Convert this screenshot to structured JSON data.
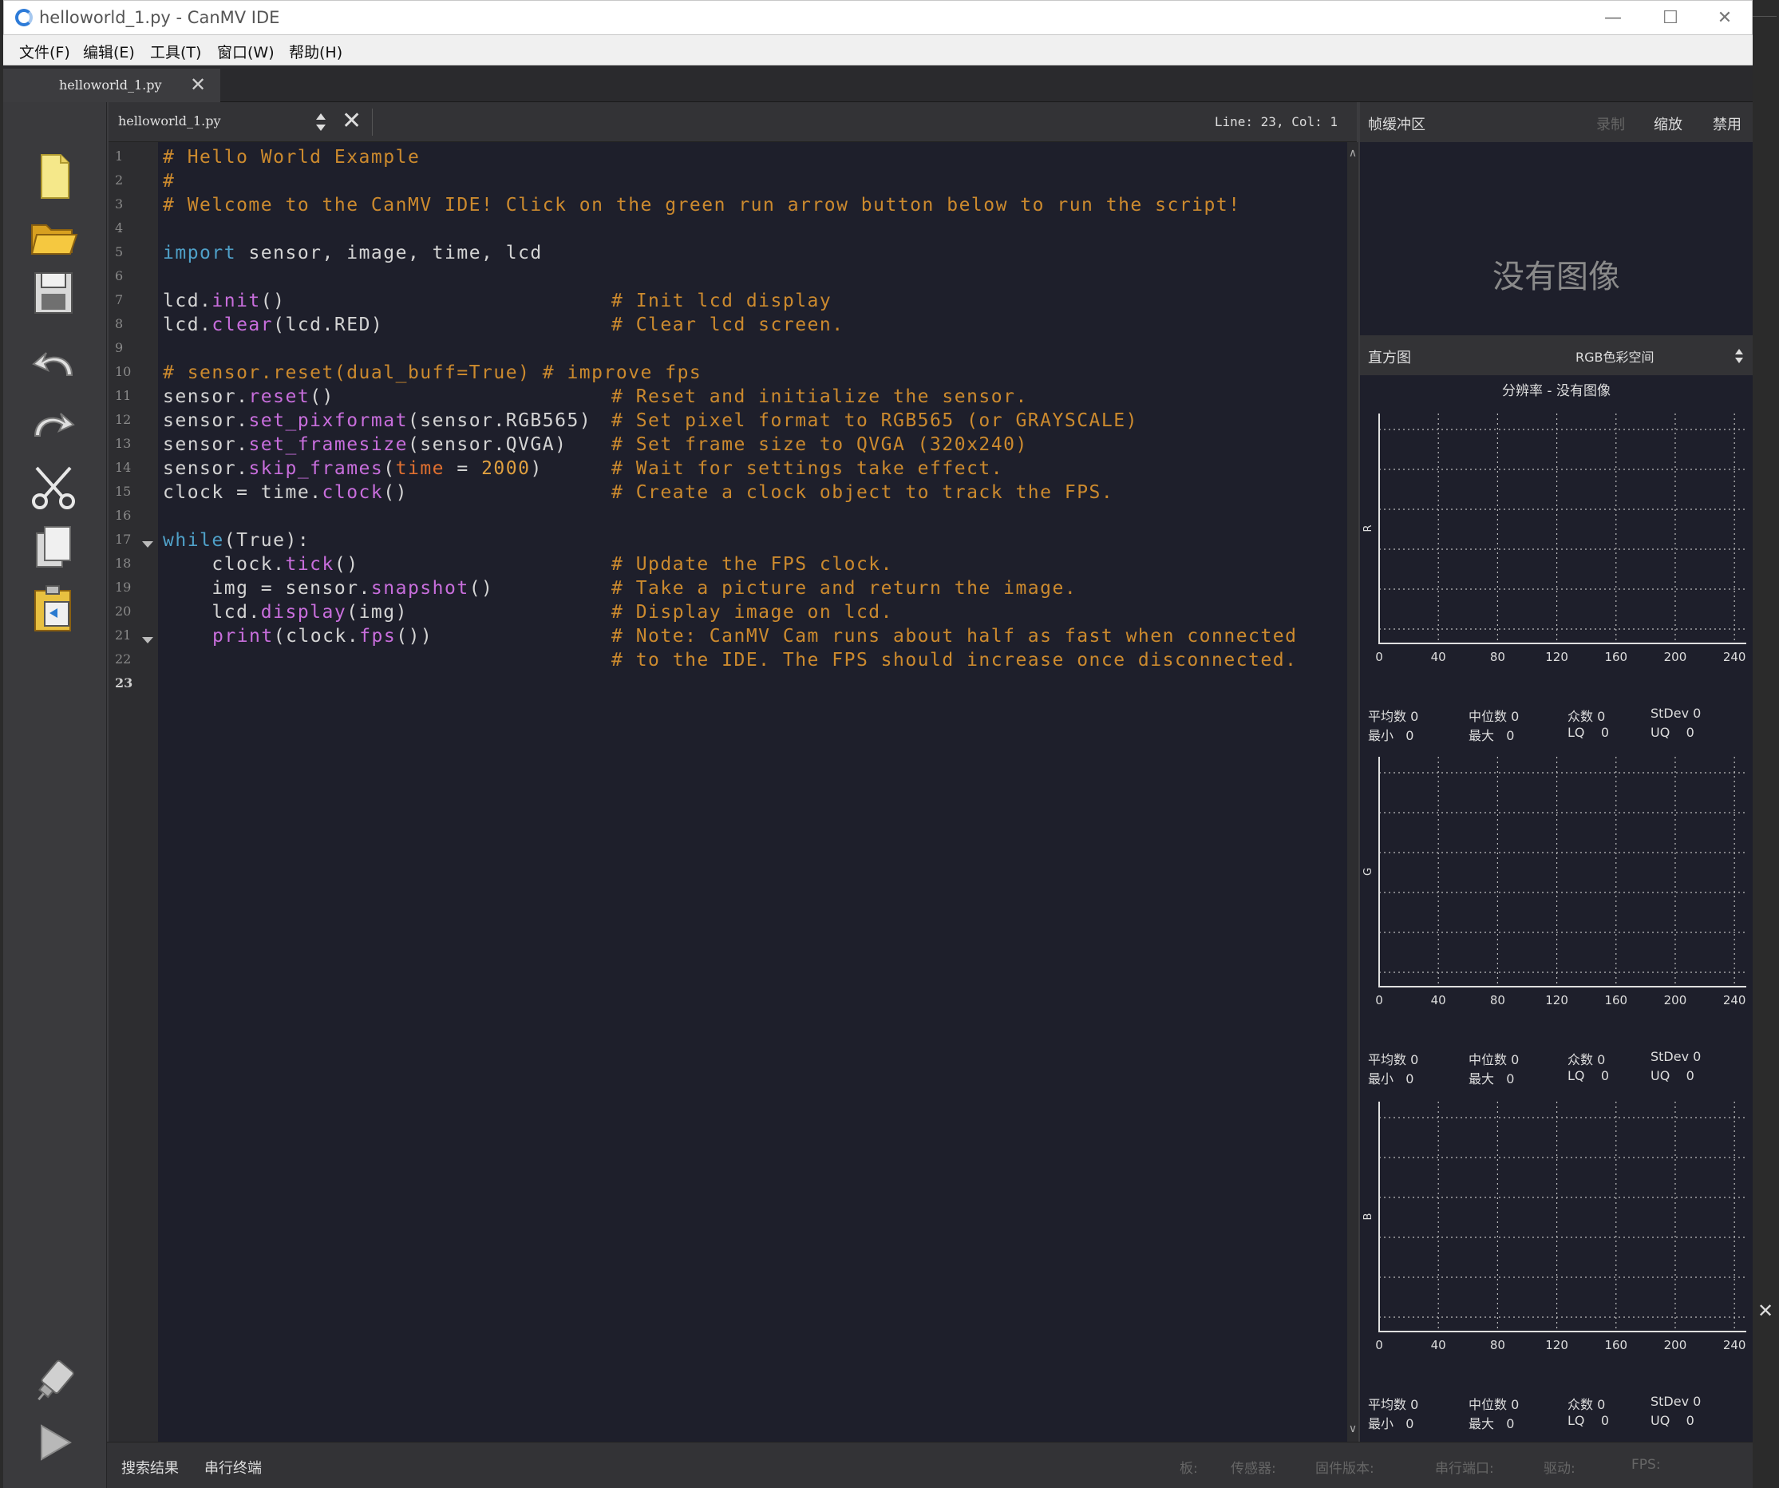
{
  "window": {
    "title": "helloworld_1.py - CanMV IDE"
  },
  "menu": [
    "文件(F)",
    "编辑(E)",
    "工具(T)",
    "窗口(W)",
    "帮助(H)"
  ],
  "tab": {
    "label": "helloworld_1.py"
  },
  "editor": {
    "filename": "helloworld_1.py",
    "position": "Line: 23, Col: 1",
    "line_numbers": [
      "1",
      "2",
      "3",
      "4",
      "5",
      "6",
      "7",
      "8",
      "9",
      "10",
      "11",
      "12",
      "13",
      "14",
      "15",
      "16",
      "17",
      "18",
      "19",
      "20",
      "21",
      "22",
      "23"
    ]
  },
  "code": {
    "l1": "# Hello World Example",
    "l2": "#",
    "l3": "# Welcome to the CanMV IDE! Click on the green run arrow button below to run the script!",
    "l5_kw": "import",
    "l5_rest": " sensor, image, time, lcd",
    "l7_a": "lcd.",
    "l7_f": "init",
    "l7_b": "()",
    "l7_c": "# Init lcd display",
    "l8_a": "lcd.",
    "l8_f": "clear",
    "l8_b": "(lcd.RED)",
    "l8_c": "# Clear lcd screen.",
    "l10": "# sensor.reset(dual_buff=True) # improve fps",
    "l11_a": "sensor.",
    "l11_f": "reset",
    "l11_b": "()",
    "l11_c": "# Reset and initialize the sensor.",
    "l12_a": "sensor.",
    "l12_f": "set_pixformat",
    "l12_b": "(sensor.RGB565)",
    "l12_c": "# Set pixel format to RGB565 (or GRAYSCALE)",
    "l13_a": "sensor.",
    "l13_f": "set_framesize",
    "l13_b": "(sensor.QVGA)",
    "l13_c": "# Set frame size to QVGA (320x240)",
    "l14_a": "sensor.",
    "l14_f": "skip_frames",
    "l14_b": "(",
    "l14_p": "time",
    "l14_e": " = ",
    "l14_n": "2000",
    "l14_d": ")",
    "l14_c": "# Wait for settings take effect.",
    "l15_a": "clock = time.",
    "l15_f": "clock",
    "l15_b": "()",
    "l15_c": "# Create a clock object to track the FPS.",
    "l17_kw": "while",
    "l17_b": "(True):",
    "l18_a": "    clock.",
    "l18_f": "tick",
    "l18_b": "()",
    "l18_c": "# Update the FPS clock.",
    "l19_a": "    img = sensor.",
    "l19_f": "snapshot",
    "l19_b": "()",
    "l19_c": "# Take a picture and return the image.",
    "l20_a": "    lcd.",
    "l20_f": "display",
    "l20_b": "(img)",
    "l20_c": "# Display image on lcd.",
    "l21_f": "print",
    "l21_b": "(clock.",
    "l21_f2": "fps",
    "l21_e": "())",
    "l21_c": "# Note: CanMV Cam runs about half as fast when connected",
    "l22_c": "# to the IDE. The FPS should increase once disconnected."
  },
  "framebuffer": {
    "title": "帧缓冲区",
    "record": "录制",
    "zoom": "缩放",
    "disable": "禁用",
    "no_image": "没有图像"
  },
  "histogram": {
    "title": "直方图",
    "colorspace": "RGB色彩空间",
    "resolution": "分辨率 - 没有图像",
    "x_ticks": [
      "0",
      "40",
      "80",
      "120",
      "160",
      "200",
      "240"
    ],
    "channels": [
      {
        "label": "R",
        "stats": {
          "mean_label": "平均数",
          "mean": "0",
          "median_label": "中位数",
          "median": "0",
          "mode_label": "众数",
          "mode": "0",
          "stdev_label": "StDev",
          "stdev": "0",
          "min_label": "最小",
          "min": "0",
          "max_label": "最大",
          "max": "0",
          "lq_label": "LQ",
          "lq": "0",
          "uq_label": "UQ",
          "uq": "0"
        }
      },
      {
        "label": "G",
        "stats": {
          "mean_label": "平均数",
          "mean": "0",
          "median_label": "中位数",
          "median": "0",
          "mode_label": "众数",
          "mode": "0",
          "stdev_label": "StDev",
          "stdev": "0",
          "min_label": "最小",
          "min": "0",
          "max_label": "最大",
          "max": "0",
          "lq_label": "LQ",
          "lq": "0",
          "uq_label": "UQ",
          "uq": "0"
        }
      },
      {
        "label": "B",
        "stats": {
          "mean_label": "平均数",
          "mean": "0",
          "median_label": "中位数",
          "median": "0",
          "mode_label": "众数",
          "mode": "0",
          "stdev_label": "StDev",
          "stdev": "0",
          "min_label": "最小",
          "min": "0",
          "max_label": "最大",
          "max": "0",
          "lq_label": "LQ",
          "lq": "0",
          "uq_label": "UQ",
          "uq": "0"
        }
      }
    ]
  },
  "bottom": {
    "search_results": "搜索结果",
    "serial_terminal": "串行终端",
    "board": "板:",
    "sensor": "传感器:",
    "firmware": "固件版本:",
    "serial_port": "串行端口:",
    "driver": "驱动:",
    "fps": "FPS:"
  },
  "icons": [
    "new-file-icon",
    "open-folder-icon",
    "save-icon",
    "undo-icon",
    "redo-icon",
    "cut-icon",
    "copy-icon",
    "paste-icon",
    "connect-icon",
    "run-icon"
  ]
}
